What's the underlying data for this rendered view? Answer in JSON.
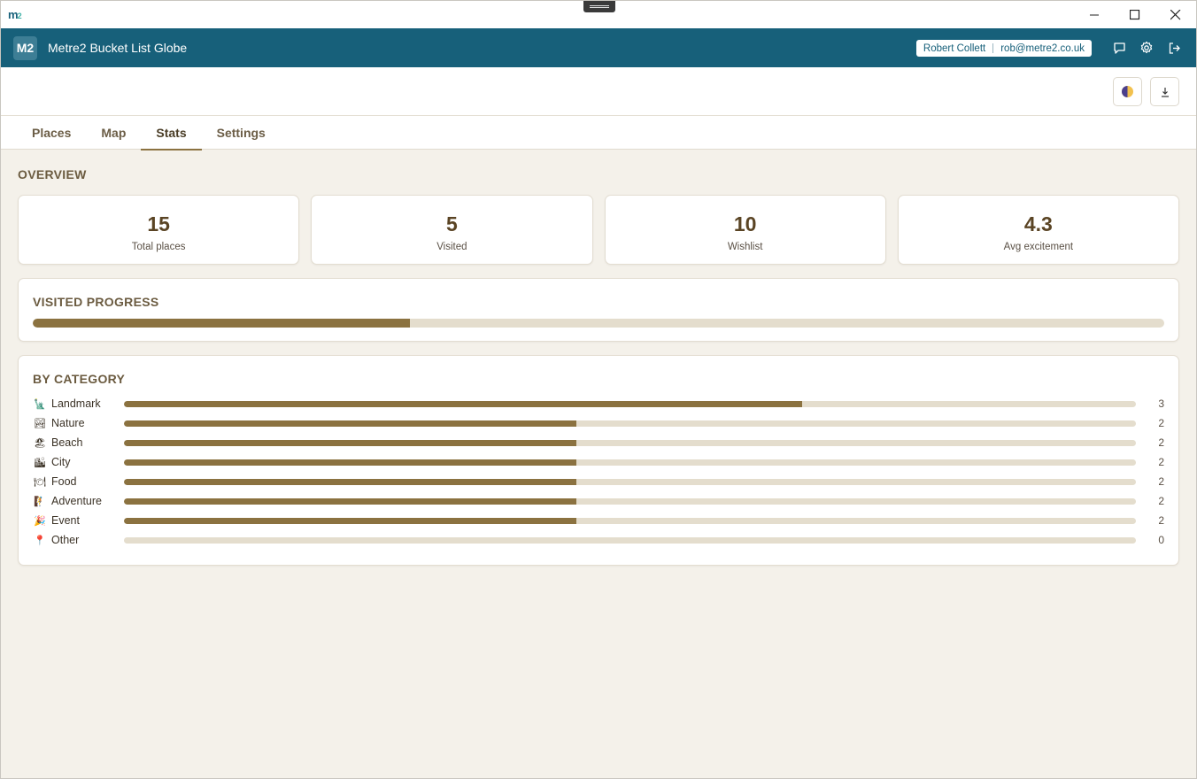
{
  "os": {
    "logo_main": "m",
    "logo_sub": "2"
  },
  "app": {
    "logo": "M2",
    "title": "Metre2 Bucket List Globe",
    "user_name": "Robert Collett",
    "user_email": "rob@metre2.co.uk"
  },
  "tabs": [
    {
      "label": "Places",
      "active": false
    },
    {
      "label": "Map",
      "active": false
    },
    {
      "label": "Stats",
      "active": true
    },
    {
      "label": "Settings",
      "active": false
    }
  ],
  "overview": {
    "title": "OVERVIEW",
    "stats": [
      {
        "value": "15",
        "label": "Total places"
      },
      {
        "value": "5",
        "label": "Visited"
      },
      {
        "value": "10",
        "label": "Wishlist"
      },
      {
        "value": "4.3",
        "label": "Avg excitement"
      }
    ]
  },
  "visited_progress": {
    "title": "VISITED PROGRESS",
    "fraction": 0.333
  },
  "by_category": {
    "title": "BY CATEGORY",
    "max": 3,
    "items": [
      {
        "icon": "🗽",
        "label": "Landmark",
        "count": 3
      },
      {
        "icon": "🏞",
        "label": "Nature",
        "count": 2
      },
      {
        "icon": "🏖",
        "label": "Beach",
        "count": 2
      },
      {
        "icon": "🏙",
        "label": "City",
        "count": 2
      },
      {
        "icon": "🍽",
        "label": "Food",
        "count": 2
      },
      {
        "icon": "🧗",
        "label": "Adventure",
        "count": 2
      },
      {
        "icon": "🎉",
        "label": "Event",
        "count": 2
      },
      {
        "icon": "📍",
        "label": "Other",
        "count": 0
      }
    ]
  },
  "colors": {
    "header": "#17607a",
    "accent": "#8b7240",
    "track": "#e4ddcd",
    "background": "#f4f1ea"
  }
}
